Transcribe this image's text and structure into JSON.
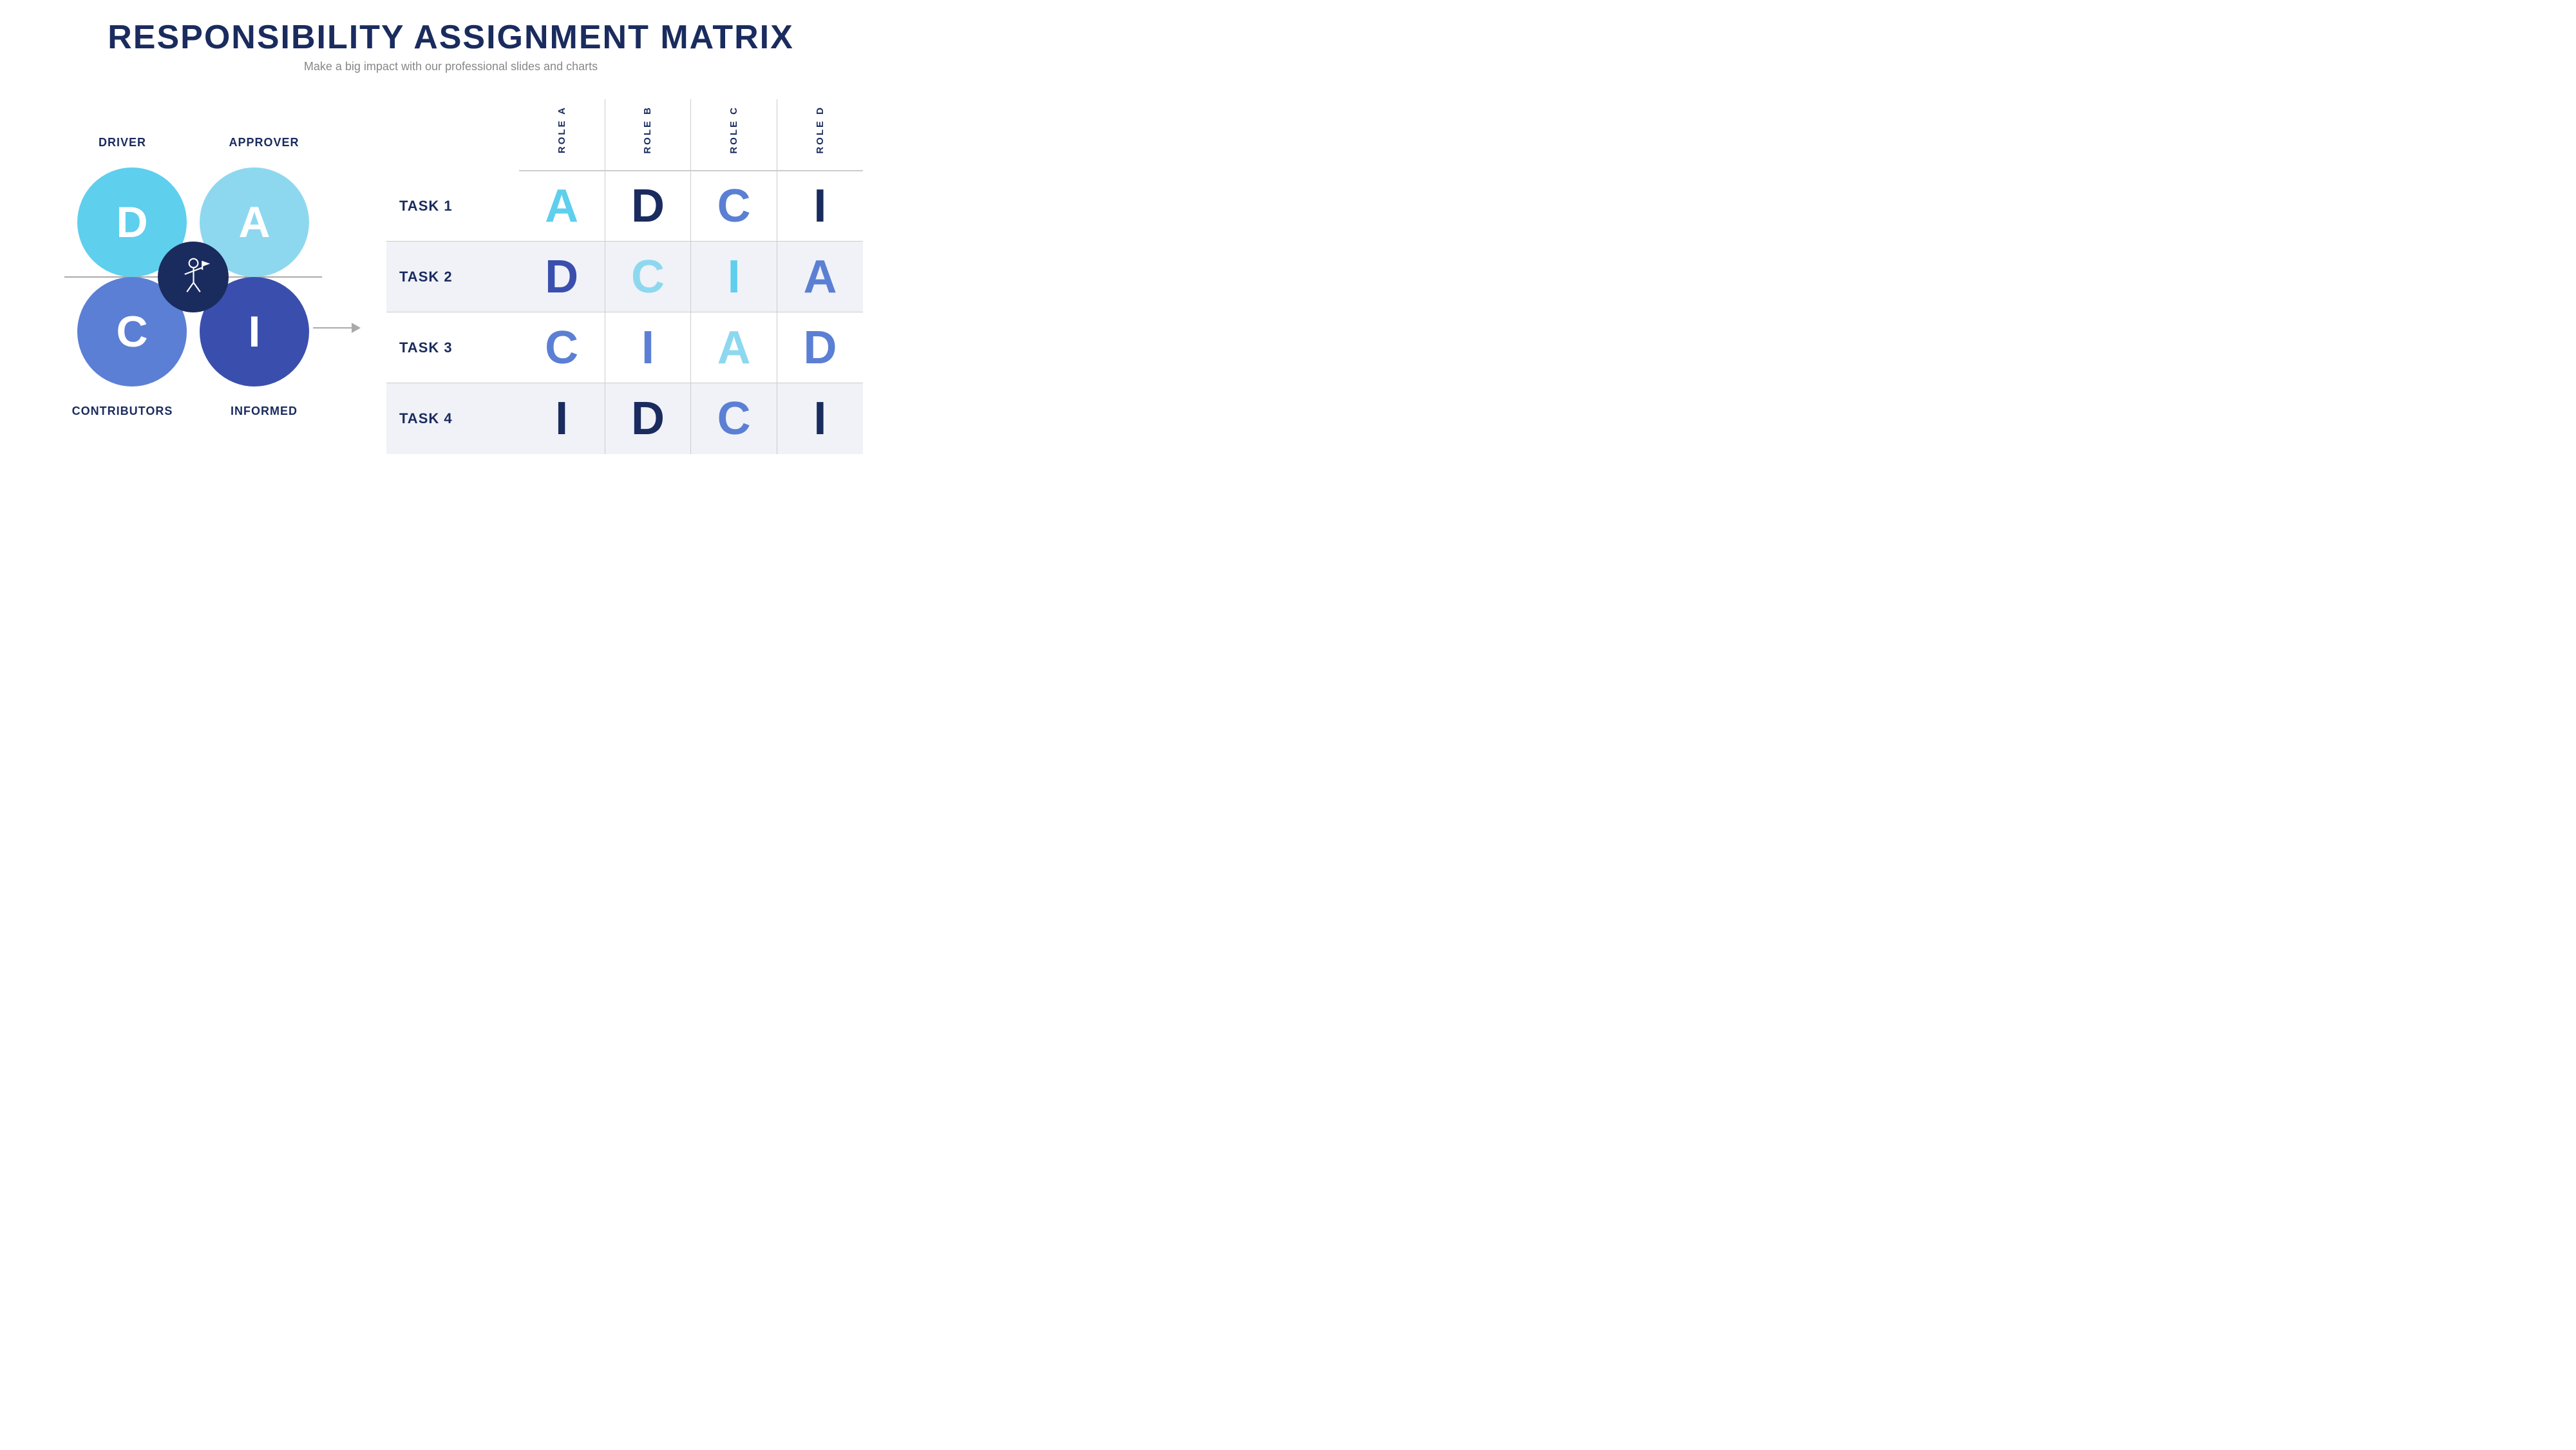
{
  "header": {
    "title": "RESPONSIBILITY ASSIGNMENT MATRIX",
    "subtitle": "Make a big impact with our professional slides and charts"
  },
  "diagram": {
    "labels": {
      "driver": "DRIVER",
      "approver": "APPROVER",
      "contributors": "CONTRIBUTORS",
      "informed": "INFORMED"
    },
    "circles": {
      "d": "D",
      "a": "A",
      "c": "C",
      "i": "I"
    }
  },
  "matrix": {
    "roles": [
      "ROLE A",
      "ROLE B",
      "ROLE C",
      "ROLE D"
    ],
    "tasks": [
      {
        "name": "TASK 1",
        "shaded": false,
        "values": [
          {
            "letter": "A",
            "class": "letter-a"
          },
          {
            "letter": "D",
            "class": "letter-d"
          },
          {
            "letter": "C",
            "class": "letter-c"
          },
          {
            "letter": "I",
            "class": "letter-i"
          }
        ]
      },
      {
        "name": "TASK 2",
        "shaded": true,
        "values": [
          {
            "letter": "D",
            "class": "letter-d-light"
          },
          {
            "letter": "C",
            "class": "letter-c-light"
          },
          {
            "letter": "I",
            "class": "letter-i-light"
          },
          {
            "letter": "A",
            "class": "letter-a-med"
          }
        ]
      },
      {
        "name": "TASK 3",
        "shaded": false,
        "values": [
          {
            "letter": "C",
            "class": "letter-c"
          },
          {
            "letter": "I",
            "class": "letter-i-med"
          },
          {
            "letter": "A",
            "class": "letter-a-light"
          },
          {
            "letter": "D",
            "class": "letter-d-med"
          }
        ]
      },
      {
        "name": "TASK 4",
        "shaded": true,
        "values": [
          {
            "letter": "I",
            "class": "letter-i"
          },
          {
            "letter": "D",
            "class": "letter-d"
          },
          {
            "letter": "C",
            "class": "letter-c"
          },
          {
            "letter": "I",
            "class": "letter-i"
          }
        ]
      }
    ]
  }
}
